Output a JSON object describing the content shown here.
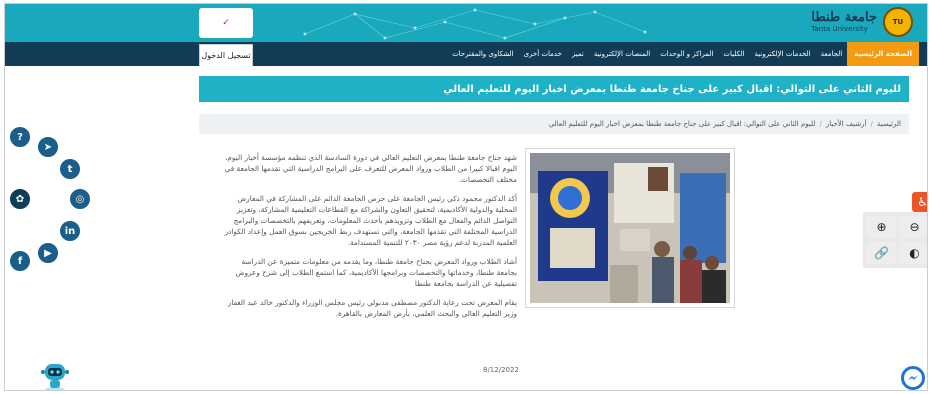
{
  "header": {
    "university_name_ar": "جامعة طنطا",
    "university_name_en": "Tanta University",
    "seal_label": "TU",
    "side_logo_label": "✓"
  },
  "nav": {
    "items": [
      {
        "label": "الصفحة الرئيسية",
        "active": true
      },
      {
        "label": "الجامعة",
        "active": false
      },
      {
        "label": "الخدمات الإلكترونية",
        "active": false
      },
      {
        "label": "الكليات",
        "active": false
      },
      {
        "label": "المراكز و الوحدات",
        "active": false
      },
      {
        "label": "المنصات الإلكترونية",
        "active": false
      },
      {
        "label": "تميز",
        "active": false
      },
      {
        "label": "خدمات أخرى",
        "active": false
      },
      {
        "label": "الشكاوى والمقترحات",
        "active": false
      }
    ],
    "login_label": "تسجيل الدخول"
  },
  "page": {
    "title": "لليوم الثاني على التوالي: اقبال كبير على جناح جامعة طنطا بمعرض اخبار اليوم للتعليم العالي",
    "breadcrumb": [
      "الرئيسية",
      "أرشيف الأخبار",
      "لليوم الثاني على التوالي: اقبال كبير على جناح جامعة طنطا بمعرض اخبار اليوم للتعليم العالي"
    ],
    "paragraphs": [
      "شهد جناح جامعة طنطا بمعرض التعليم العالي في دورة السادسة الذي تنظمه مؤسسة أخبار اليوم، اليوم اقبالا كبيرا من الطلاب ورواد المعرض للتعرف على البرامج الدراسية التي تقدمها الجامعة في مختلف التخصصات.",
      "أكد الدكتور محمود ذكي رئيس الجامعة على حرص الجامعة الدائم على المشاركة في المعارض المحلية والدولية الأكاديمية، لتحقيق التعاون والشراكة مع القطاعات التعليمية المشاركة، وتعزيز التواصل الدائم والفعال مع الطلاب وتزويدهم بأحدث المعلومات، وتعريفهم بالتخصصات والبرامج الدراسية المختلفة التي تقدمها الجامعة، والتي تستهدف ربط الخريجين بسوق العمل وإعداد الكوادر العلمية المدربة لدعم رؤية مصر ٢٠٣٠ للتنمية المستدامة.",
      "أشاد الطلاب ورواد المعرض بجناح جامعة طنطا، وما يقدمه من معلومات متميزة عن الدراسة بجامعة طنطا، وخدماتها والتخصصات وبرامجها الأكاديمية، كما استمع الطلاب إلى شرح وعروض تفصيلية عن الدراسة بجامعة طنطا",
      "يقام المعرض تحت رعاية الدكتور مصطفى مدبولي رئيس مجلس الوزراء والدكتور خالد عبد الغفار وزير التعليم العالي والبحث العلمي، بأرض المعارض بالقاهرة."
    ],
    "date": "8/12/2022"
  },
  "social": {
    "help": "?",
    "telegram": "➤",
    "twitter": "t",
    "settings": "✿",
    "instagram": "◎",
    "linkedin": "in",
    "youtube": "▶",
    "facebook": "f"
  },
  "accessibility": {
    "toggle": "♿",
    "zoom_in": "⊕",
    "zoom_out": "⊖",
    "link": "🔗",
    "contrast": "◐"
  }
}
